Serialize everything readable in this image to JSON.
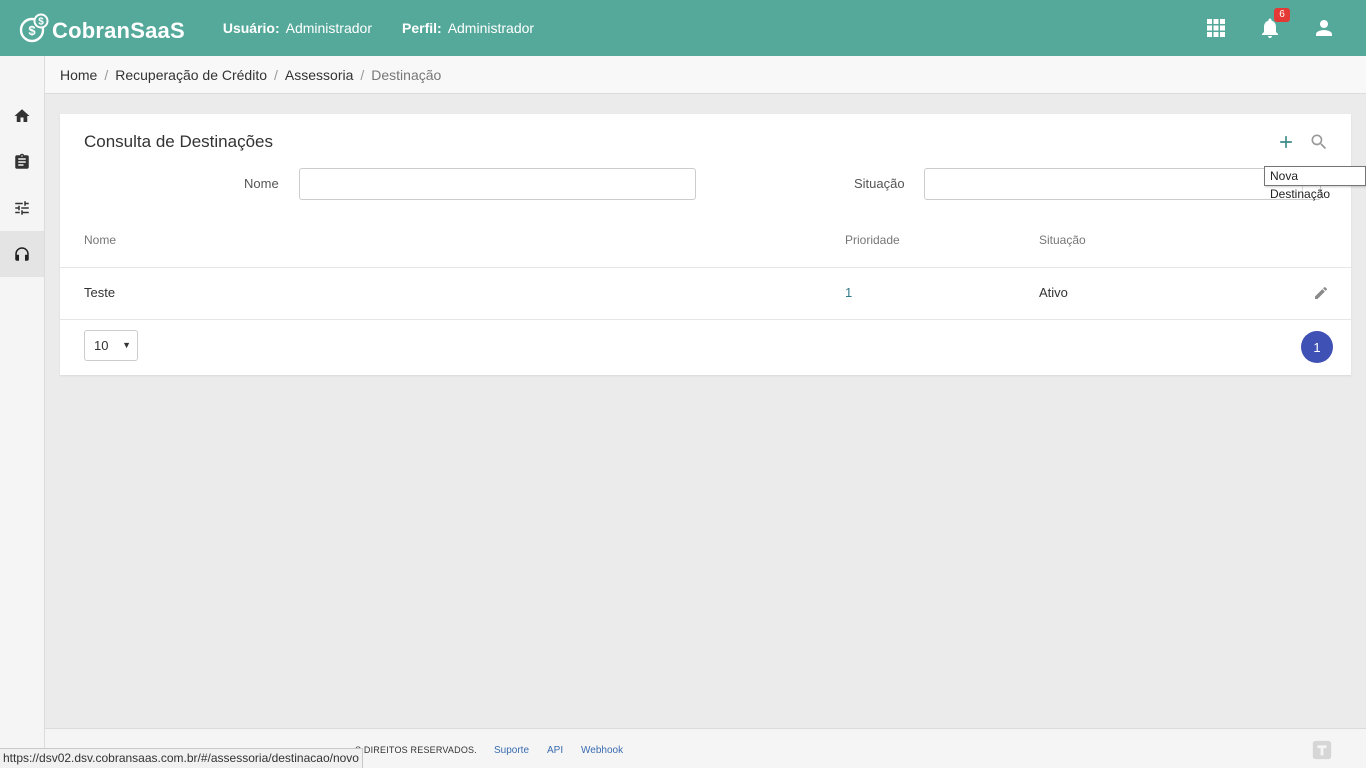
{
  "app": {
    "brand": "CobranSaaS"
  },
  "header": {
    "user_label": "Usuário:",
    "user_value": "Administrador",
    "profile_label": "Perfil:",
    "profile_value": "Administrador",
    "notification_count": "6",
    "icons": [
      "apps-grid-icon",
      "bell-icon",
      "user-icon"
    ],
    "color": "#55a99a"
  },
  "sidebar": {
    "items": [
      {
        "icon": "home-icon",
        "active": false
      },
      {
        "icon": "clipboard-icon",
        "active": false
      },
      {
        "icon": "sliders-icon",
        "active": false
      },
      {
        "icon": "headset-icon",
        "active": true
      }
    ]
  },
  "breadcrumb": {
    "items": [
      "Home",
      "Recuperação de Crédito",
      "Assessoria"
    ],
    "current": "Destinação",
    "separator": "/"
  },
  "main": {
    "title": "Consulta de Destinações",
    "filters": {
      "nome_label": "Nome",
      "nome_value": "",
      "situacao_label": "Situação",
      "situacao_value": ""
    },
    "table": {
      "headers": [
        "Nome",
        "Prioridade",
        "Situação"
      ],
      "rows": [
        {
          "nome": "Teste",
          "prioridade": "1",
          "situacao": "Ativo"
        }
      ]
    },
    "pagination": {
      "page_size": "10",
      "current_page": "1"
    },
    "accent_color": "#3f51b5"
  },
  "tooltip": {
    "text": "Nova Destinação"
  },
  "footer": {
    "copyright": "S DIREITOS RESERVADOS.",
    "links": [
      "Suporte",
      "API",
      "Webhook"
    ]
  },
  "status_bar": {
    "url": "https://dsv02.dsv.cobransaas.com.br/#/assessoria/destinacao/novo"
  }
}
